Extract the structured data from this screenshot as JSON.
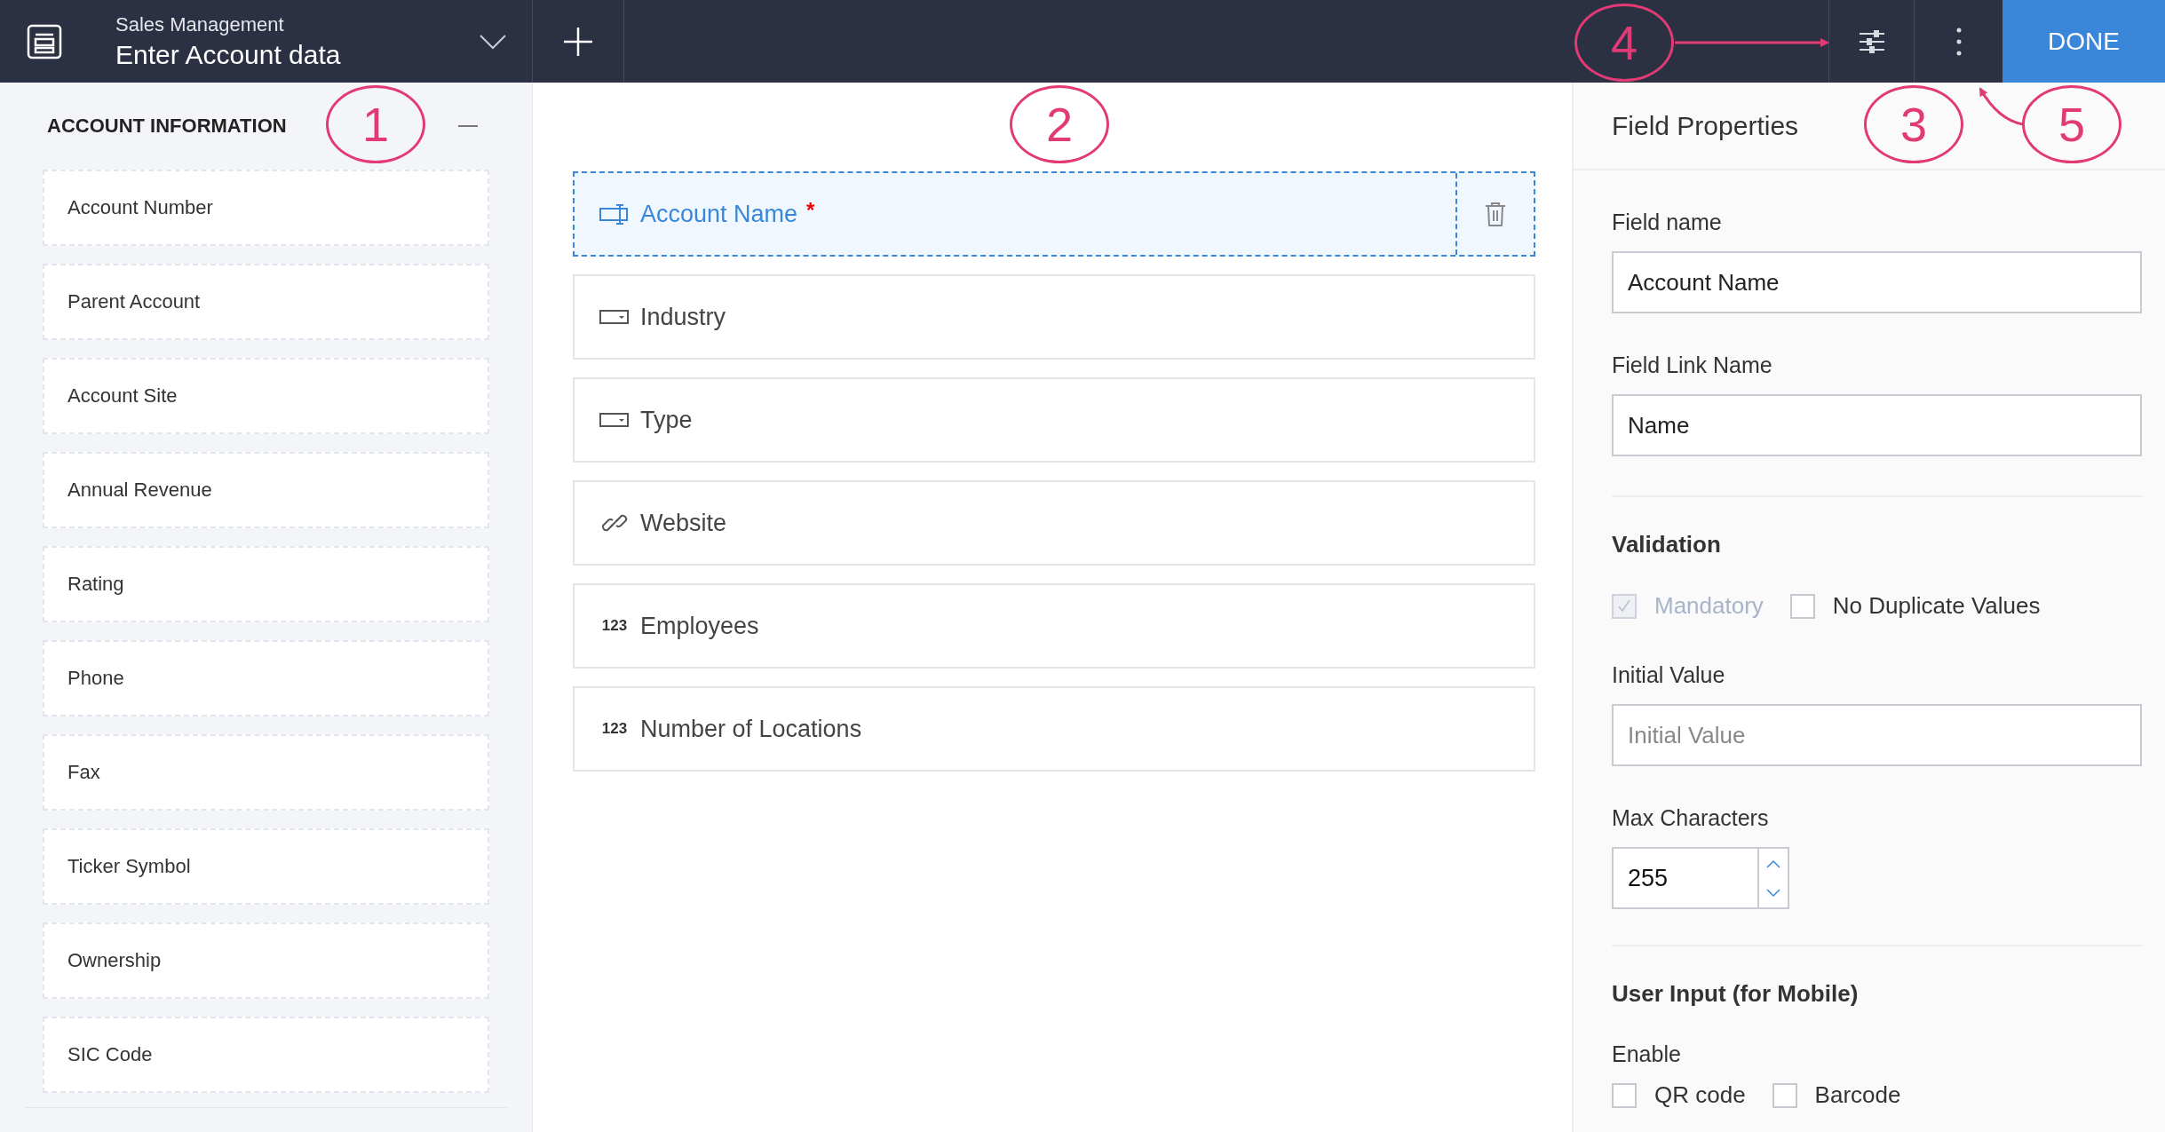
{
  "header": {
    "app_name": "Sales Management",
    "form_name": "Enter Account data",
    "done_button": "DONE"
  },
  "section": {
    "title": "ACCOUNT INFORMATION",
    "expanded": true,
    "fields": [
      "Account Number",
      "Parent Account",
      "Account Site",
      "Annual Revenue",
      "Rating",
      "Phone",
      "Fax",
      "Ticker Symbol",
      "Ownership",
      "SIC Code"
    ]
  },
  "form_fields": [
    {
      "label": "Account Name",
      "kind": "text",
      "required_mark": "*",
      "selected": true
    },
    {
      "label": "Industry",
      "kind": "dropdown",
      "selected": false
    },
    {
      "label": "Type",
      "kind": "dropdown",
      "selected": false
    },
    {
      "label": "Website",
      "kind": "url",
      "selected": false
    },
    {
      "label": "Employees",
      "kind": "number",
      "badge": "123",
      "selected": false
    },
    {
      "label": "Number of Locations",
      "kind": "number",
      "badge": "123",
      "selected": false
    }
  ],
  "properties": {
    "title": "Field Properties",
    "field_name_label": "Field name",
    "field_name_value": "Account Name",
    "link_label": "Field Link Name",
    "link_value": "Name",
    "validation_title": "Validation",
    "validation_options": [
      {
        "label": "Mandatory",
        "checked": true,
        "disabled": true
      },
      {
        "label": "No Duplicate Values",
        "checked": false,
        "disabled": false
      }
    ],
    "initial_label": "Initial Value",
    "initial_placeholder": "Initial Value",
    "max_label": "Max Characters",
    "max_value": "255",
    "mobile_title": "User Input (for Mobile)",
    "enable_label": "Enable",
    "enable_options": [
      {
        "label": "QR code",
        "checked": false
      },
      {
        "label": "Barcode",
        "checked": false
      }
    ]
  },
  "annotations": [
    "1",
    "2",
    "3",
    "4",
    "5"
  ]
}
